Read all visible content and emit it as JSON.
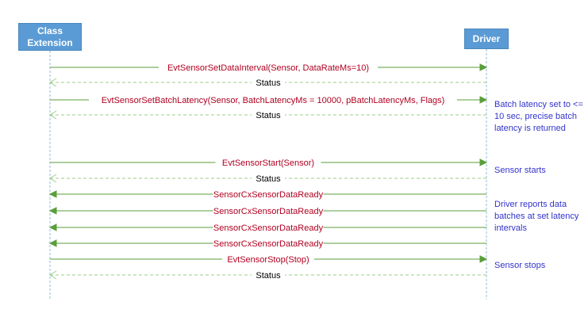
{
  "participants": {
    "left": "Class\nExtension",
    "right": "Driver"
  },
  "colors": {
    "participant_fill": "#5b9bd5",
    "lifeline": "#8fbcd9",
    "call_arrow": "#5a9e3a",
    "call_text": "#b00020",
    "return_arrow": "#9ccc8a",
    "return_text": "#000000",
    "note_text": "#3333cc"
  },
  "messages": [
    {
      "label": "EvtSensorSetDataInterval(Sensor, DataRateMs=10)",
      "dir": "right",
      "kind": "call"
    },
    {
      "label": "Status",
      "dir": "left",
      "kind": "return"
    },
    {
      "label": "EvtSensorSetBatchLatency(Sensor, BatchLatencyMs = 10000, pBatchLatencyMs, Flags)",
      "dir": "right",
      "kind": "call"
    },
    {
      "label": "Status",
      "dir": "left",
      "kind": "return"
    },
    {
      "label": "EvtSensorStart(Sensor)",
      "dir": "right",
      "kind": "call"
    },
    {
      "label": "Status",
      "dir": "left",
      "kind": "return"
    },
    {
      "label": "SensorCxSensorDataReady",
      "dir": "left",
      "kind": "call"
    },
    {
      "label": "SensorCxSensorDataReady",
      "dir": "left",
      "kind": "call"
    },
    {
      "label": "SensorCxSensorDataReady",
      "dir": "left",
      "kind": "call"
    },
    {
      "label": "SensorCxSensorDataReady",
      "dir": "left",
      "kind": "call"
    },
    {
      "label": "EvtSensorStop(Stop)",
      "dir": "right",
      "kind": "call"
    },
    {
      "label": "Status",
      "dir": "left",
      "kind": "return"
    }
  ],
  "notes": [
    {
      "text": "Batch latency set to <= 10 sec, precise batch latency is returned"
    },
    {
      "text": "Sensor starts"
    },
    {
      "text": "Driver reports data batches at set latency intervals"
    },
    {
      "text": "Sensor stops"
    }
  ]
}
